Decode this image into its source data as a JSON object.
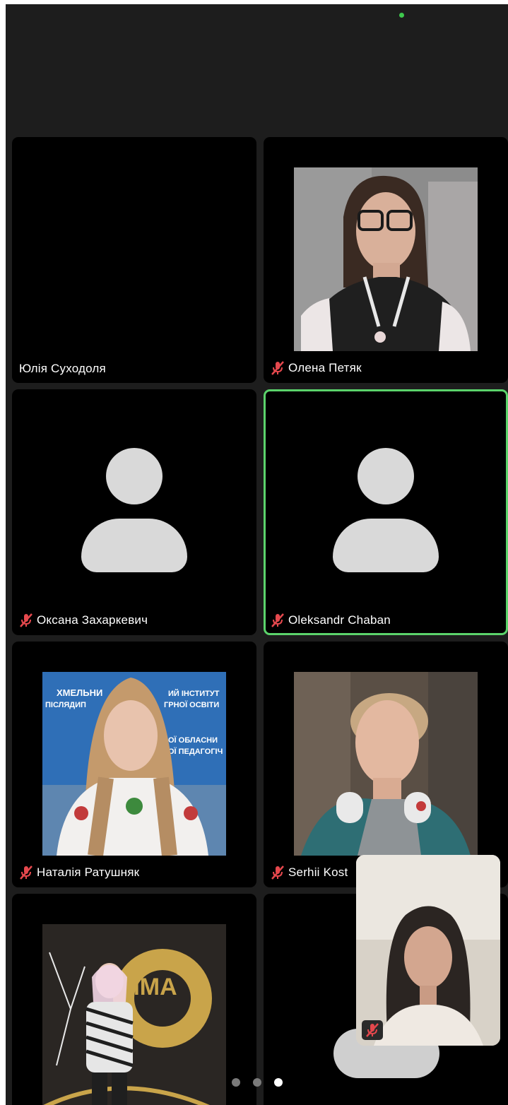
{
  "status": {
    "indicator_color": "#3ec94d"
  },
  "participants": [
    {
      "name": "Юлія Суходоля",
      "muted": false,
      "video": "off-black"
    },
    {
      "name": "Олена Петяк",
      "muted": true,
      "video": "camera"
    },
    {
      "name": "Оксана Захаркевич",
      "muted": true,
      "video": "avatar"
    },
    {
      "name": "Oleksandr Chaban",
      "muted": true,
      "video": "avatar",
      "active_speaker": true
    },
    {
      "name": "Наталія Ратушняк",
      "muted": true,
      "video": "camera"
    },
    {
      "name": "Serhii Kost",
      "muted": true,
      "video": "camera"
    },
    {
      "name": "",
      "muted": false,
      "video": "camera"
    },
    {
      "name": "",
      "muted": false,
      "video": "avatar-partial"
    }
  ],
  "self_view": {
    "muted": true
  },
  "background_sign": {
    "line1": "ХМЕЛЬНИ",
    "line1b": "ИЙ ІНСТИТУТ",
    "line2": "ПІСЛЯДИП",
    "line2b": "ГРНОЇ ОСВІТИ",
    "line3": "ОЇ ОБЛАСНИ",
    "line4": "ОЇ ПЕДАГОГІЧ"
  },
  "brand_sign": "IMMA",
  "pagination": {
    "count": 3,
    "current": 3
  },
  "colors": {
    "background": "#1d1d1d",
    "tile": "#000000",
    "active_border": "#5bd36b",
    "muted_icon": "#e5484d",
    "avatar": "#d9d9d9"
  }
}
